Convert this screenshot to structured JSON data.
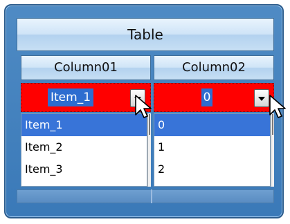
{
  "table": {
    "title": "Table",
    "columns": [
      {
        "header": "Column01",
        "combo_value": "Item_1",
        "options": [
          "Item_1",
          "Item_2",
          "Item_3"
        ],
        "selected_index": 0
      },
      {
        "header": "Column02",
        "combo_value": "0",
        "options": [
          "0",
          "1",
          "2"
        ],
        "selected_index": 0
      }
    ]
  },
  "colors": {
    "frame": "#3a79b8",
    "combo_background": "#ff0000",
    "selection": "#3874d8"
  },
  "icons": [
    "dropdown-arrow-icon",
    "mouse-pointer-icon"
  ]
}
